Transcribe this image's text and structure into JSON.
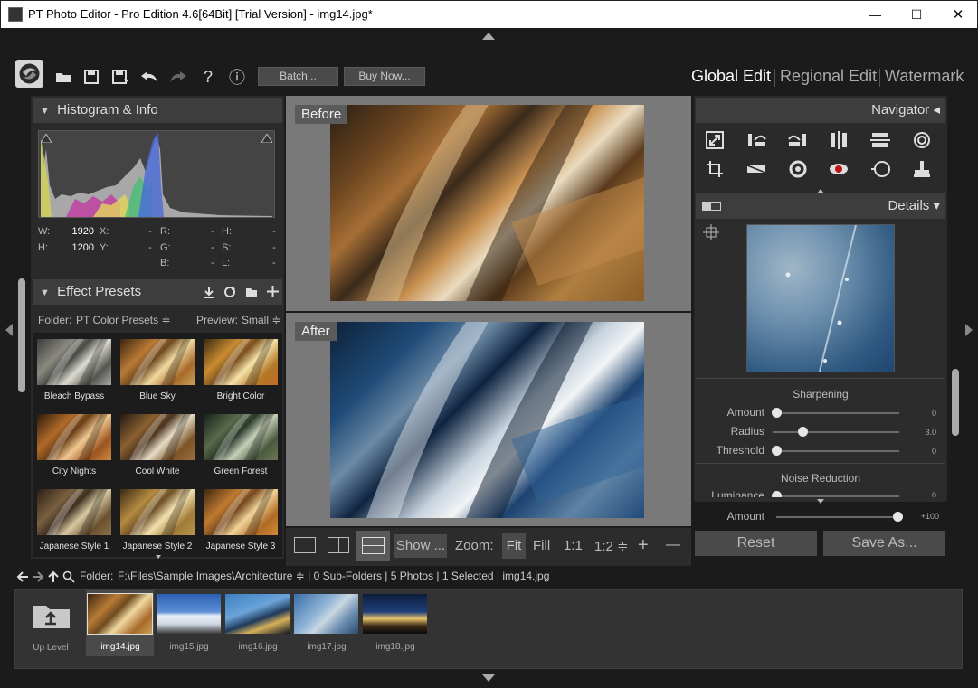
{
  "window": {
    "title": "PT Photo Editor - Pro Edition 4.6[64Bit] [Trial Version] - img14.jpg*",
    "min_glyph": "—",
    "max_glyph": "☐",
    "close_glyph": "✕"
  },
  "toolbar": {
    "batch_label": "Batch...",
    "buy_label": "Buy Now...",
    "help_glyph": "?",
    "info_glyph": "ⓘ"
  },
  "modes": {
    "global": "Global Edit",
    "regional": "Regional Edit",
    "watermark": "Watermark"
  },
  "histogram": {
    "title": "Histogram & Info",
    "W_label": "W:",
    "W_value": "1920",
    "H_label": "H:",
    "H_value": "1200",
    "X_label": "X:",
    "X_value": "-",
    "Y_label": "Y:",
    "Y_value": "-",
    "R_label": "R:",
    "R_value": "-",
    "G_label": "G:",
    "G_value": "-",
    "B_label": "B:",
    "B_value": "-",
    "Hh_label": "H:",
    "Hh_value": "-",
    "S_label": "S:",
    "S_value": "-",
    "L_label": "L:",
    "L_value": "-"
  },
  "presets": {
    "title": "Effect Presets",
    "folder_label": "Folder:",
    "folder_value": "PT Color Presets ≑",
    "preview_label": "Preview:",
    "preview_value": "Small ≑",
    "items": [
      {
        "label": "Bleach Bypass"
      },
      {
        "label": "Blue Sky"
      },
      {
        "label": "Bright Color"
      },
      {
        "label": "City Nights"
      },
      {
        "label": "Cool White"
      },
      {
        "label": "Green Forest"
      },
      {
        "label": "Japanese Style 1"
      },
      {
        "label": "Japanese Style 2"
      },
      {
        "label": "Japanese Style 3"
      }
    ]
  },
  "viewer": {
    "before_label": "Before",
    "after_label": "After",
    "show_label": "Show ...",
    "zoom_label": "Zoom:",
    "fit_label": "Fit",
    "fill_label": "Fill",
    "one_to_one": "1:1",
    "one_to_two": "1:2 ≑",
    "zoom_in": "+",
    "zoom_out": "—"
  },
  "navigator": {
    "title": "Navigator ◂"
  },
  "details": {
    "title": "Details ▾",
    "sharpening_title": "Sharpening",
    "amount_label": "Amount",
    "amount_value": "0",
    "amount_level": 0,
    "radius_label": "Radius",
    "radius_value": "3.0",
    "radius_level": 0.22,
    "threshold_label": "Threshold",
    "threshold_value": "0",
    "threshold_level": 0,
    "noise_title": "Noise Reduction",
    "luminance_label": "Luminance",
    "luminance_value": "0"
  },
  "amount_row": {
    "label": "Amount",
    "value": "+100",
    "level": 1.0
  },
  "actions": {
    "reset": "Reset",
    "save_as": "Save As..."
  },
  "browser": {
    "folder_label": "Folder:",
    "path": "F:\\Files\\Sample Images\\Architecture ≑ | 0 Sub-Folders | 5 Photos | 1 Selected | img14.jpg",
    "up_level": "Up Level",
    "files": [
      {
        "label": "img14.jpg"
      },
      {
        "label": "img15.jpg"
      },
      {
        "label": "img16.jpg"
      },
      {
        "label": "img17.jpg"
      },
      {
        "label": "img18.jpg"
      }
    ]
  },
  "colors": {
    "background": "#1b1b1b",
    "panel": "#2b2b2b",
    "panel_header": "#3d3d3d",
    "accent_white": "#ffffff",
    "muted_text": "#bbbbbb"
  }
}
